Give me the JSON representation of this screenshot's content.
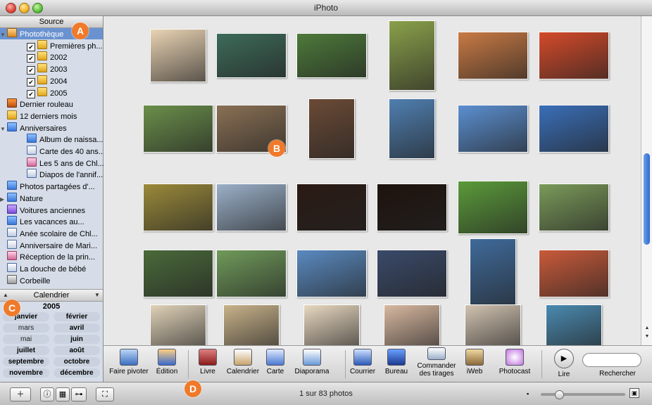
{
  "window": {
    "title": "iPhoto"
  },
  "sidebar": {
    "header": "Source",
    "items": [
      {
        "label": "Photothèque",
        "icon": "library-icon",
        "expanded": true,
        "selected": true,
        "depth": 0
      },
      {
        "label": "Premières ph...",
        "icon": "folder-icon",
        "checked": true,
        "depth": 1
      },
      {
        "label": "2002",
        "icon": "folder-icon",
        "checked": true,
        "depth": 1
      },
      {
        "label": "2003",
        "icon": "folder-icon",
        "checked": true,
        "depth": 1
      },
      {
        "label": "2004",
        "icon": "folder-icon",
        "checked": true,
        "depth": 1
      },
      {
        "label": "2005",
        "icon": "folder-icon",
        "checked": true,
        "depth": 1
      },
      {
        "label": "Dernier rouleau",
        "icon": "roll-icon",
        "depth": 0
      },
      {
        "label": "12 derniers mois",
        "icon": "calendar-folder-icon",
        "depth": 0
      },
      {
        "label": "Anniversaires",
        "icon": "folder-blue-icon",
        "expanded": true,
        "depth": 0
      },
      {
        "label": "Album de naissa...",
        "icon": "album-icon",
        "depth": 1
      },
      {
        "label": "Carte des 40 ans...",
        "icon": "card-icon",
        "depth": 1
      },
      {
        "label": "Les 5 ans de Chl...",
        "icon": "card-pink-icon",
        "depth": 1
      },
      {
        "label": "Diapos de l'annif...",
        "icon": "slideshow-icon",
        "depth": 1
      },
      {
        "label": "Photos partagées d'...",
        "icon": "shared-folder-icon",
        "depth": 0
      },
      {
        "label": "Nature",
        "icon": "folder-blue-icon",
        "collapsed": true,
        "depth": 0
      },
      {
        "label": "Voitures anciennes",
        "icon": "smart-album-icon",
        "depth": 0
      },
      {
        "label": "Les vacances au...",
        "icon": "album-icon",
        "depth": 0
      },
      {
        "label": "Anée scolaire de Chl...",
        "icon": "book-icon",
        "depth": 0
      },
      {
        "label": "Anniversaire de Mari...",
        "icon": "card-icon",
        "depth": 0
      },
      {
        "label": "Réception de la prin...",
        "icon": "card-pink-icon",
        "depth": 0
      },
      {
        "label": "La douche de bébé",
        "icon": "slideshow-icon",
        "depth": 0
      },
      {
        "label": "Corbeille",
        "icon": "trash-icon",
        "depth": 0
      }
    ]
  },
  "calendar": {
    "header": "Calendrier",
    "year": "2005",
    "months": [
      {
        "label": "janvier",
        "bold": true
      },
      {
        "label": "février",
        "bold": true
      },
      {
        "label": "mars",
        "bold": false
      },
      {
        "label": "avril",
        "bold": true
      },
      {
        "label": "mai",
        "bold": false
      },
      {
        "label": "juin",
        "bold": true
      },
      {
        "label": "juillet",
        "bold": true
      },
      {
        "label": "août",
        "bold": true
      },
      {
        "label": "septembre",
        "bold": true
      },
      {
        "label": "octobre",
        "bold": true
      },
      {
        "label": "novembre",
        "bold": true
      },
      {
        "label": "décembre",
        "bold": true
      }
    ]
  },
  "photos": {
    "rows": [
      [
        "#e9d3b3",
        "#3d6b5a",
        "#4d7a3a",
        "#8aa04a",
        "#c97a44",
        "#d44a2a"
      ],
      [
        "#6a8f4a",
        "#8a7054",
        "#6b4a36",
        "#4f7fb0",
        "#5b8fd0",
        "#3a6fb8"
      ],
      [
        "#9a8a3a",
        "#9ab0c8",
        "#2a1a14",
        "#1e130e",
        "#5b9a3a",
        "#7a9a5a"
      ],
      [
        "#4a6a3a",
        "#6f9a5a",
        "#5a8ac0",
        "#3a4a6a",
        "#3f6a9a",
        "#c95a3a"
      ],
      [
        "#e0d2b8",
        "#c8b28a",
        "#e8d8c0",
        "#d8b8a0",
        "#d0c2b0",
        "#4a8ab0"
      ]
    ]
  },
  "toolbar": {
    "left": [
      {
        "label": "Faire pivoter",
        "icon": "rotate-icon"
      },
      {
        "label": "Édition",
        "icon": "edit-icon"
      }
    ],
    "middle": [
      {
        "label": "Livre",
        "icon": "book-add-icon"
      },
      {
        "label": "Calendrier",
        "icon": "calendar-add-icon"
      },
      {
        "label": "Carte",
        "icon": "card-add-icon"
      },
      {
        "label": "Diaporama",
        "icon": "slideshow-add-icon"
      }
    ],
    "share": [
      {
        "label": "Courrier",
        "icon": "mail-icon"
      },
      {
        "label": "Bureau",
        "icon": "desktop-icon"
      },
      {
        "label": "Commander des tirages",
        "icon": "prints-icon"
      },
      {
        "label": "iWeb",
        "icon": "iweb-icon"
      },
      {
        "label": "Photocast",
        "icon": "photocast-icon"
      }
    ],
    "play": {
      "label": "Lire",
      "icon": "play-icon"
    },
    "search": {
      "label": "Rechercher",
      "placeholder": ""
    }
  },
  "bottombar": {
    "count": "1 sur 83 photos"
  },
  "callouts": [
    "A",
    "B",
    "C",
    "D"
  ]
}
